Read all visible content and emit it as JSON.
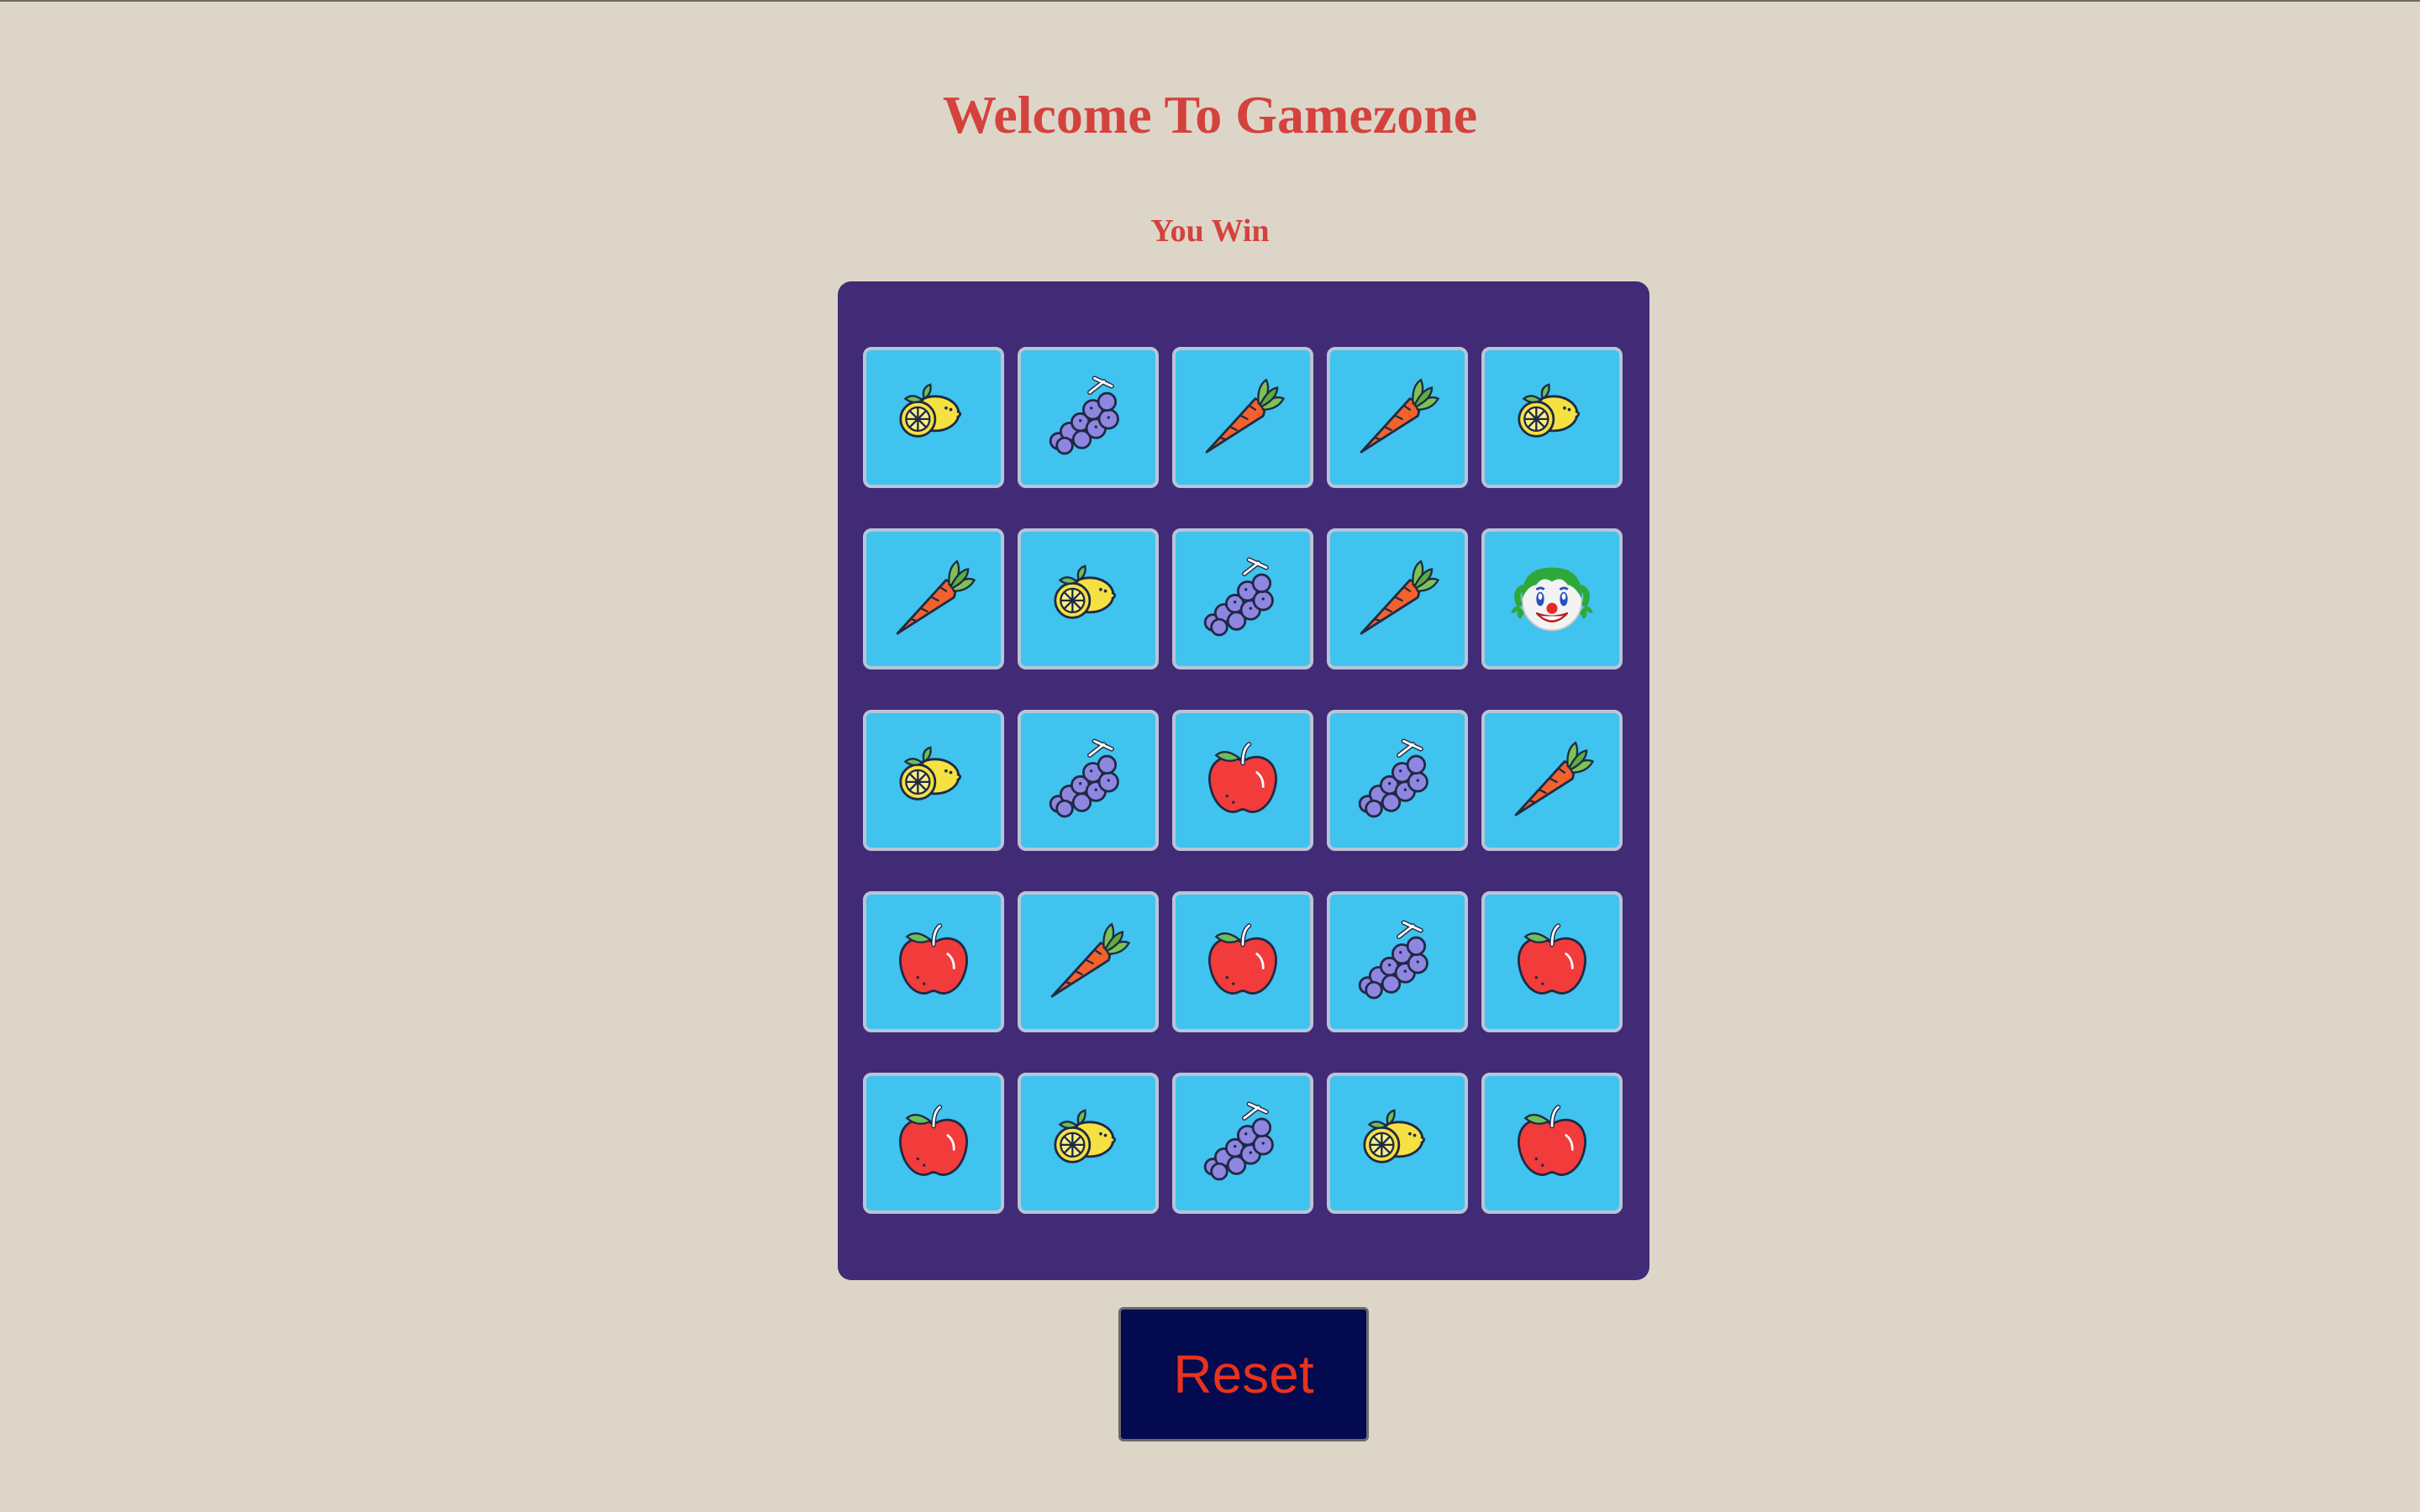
{
  "header": {
    "title": "Welcome To Gamezone",
    "status": "You Win"
  },
  "board": {
    "rows": [
      [
        "lemon",
        "grapes",
        "carrot",
        "carrot",
        "lemon"
      ],
      [
        "carrot",
        "lemon",
        "grapes",
        "carrot",
        "joker"
      ],
      [
        "lemon",
        "grapes",
        "apple",
        "grapes",
        "carrot"
      ],
      [
        "apple",
        "carrot",
        "apple",
        "grapes",
        "apple"
      ],
      [
        "apple",
        "lemon",
        "grapes",
        "lemon",
        "apple"
      ]
    ]
  },
  "controls": {
    "reset_label": "Reset"
  },
  "colors": {
    "background": "#ddd6c8",
    "title": "#d4423e",
    "board": "#412b77",
    "card": "#40c3ee",
    "card_border": "#b9c4d6",
    "reset_bg": "#030a4f",
    "reset_text": "#e8321e"
  }
}
